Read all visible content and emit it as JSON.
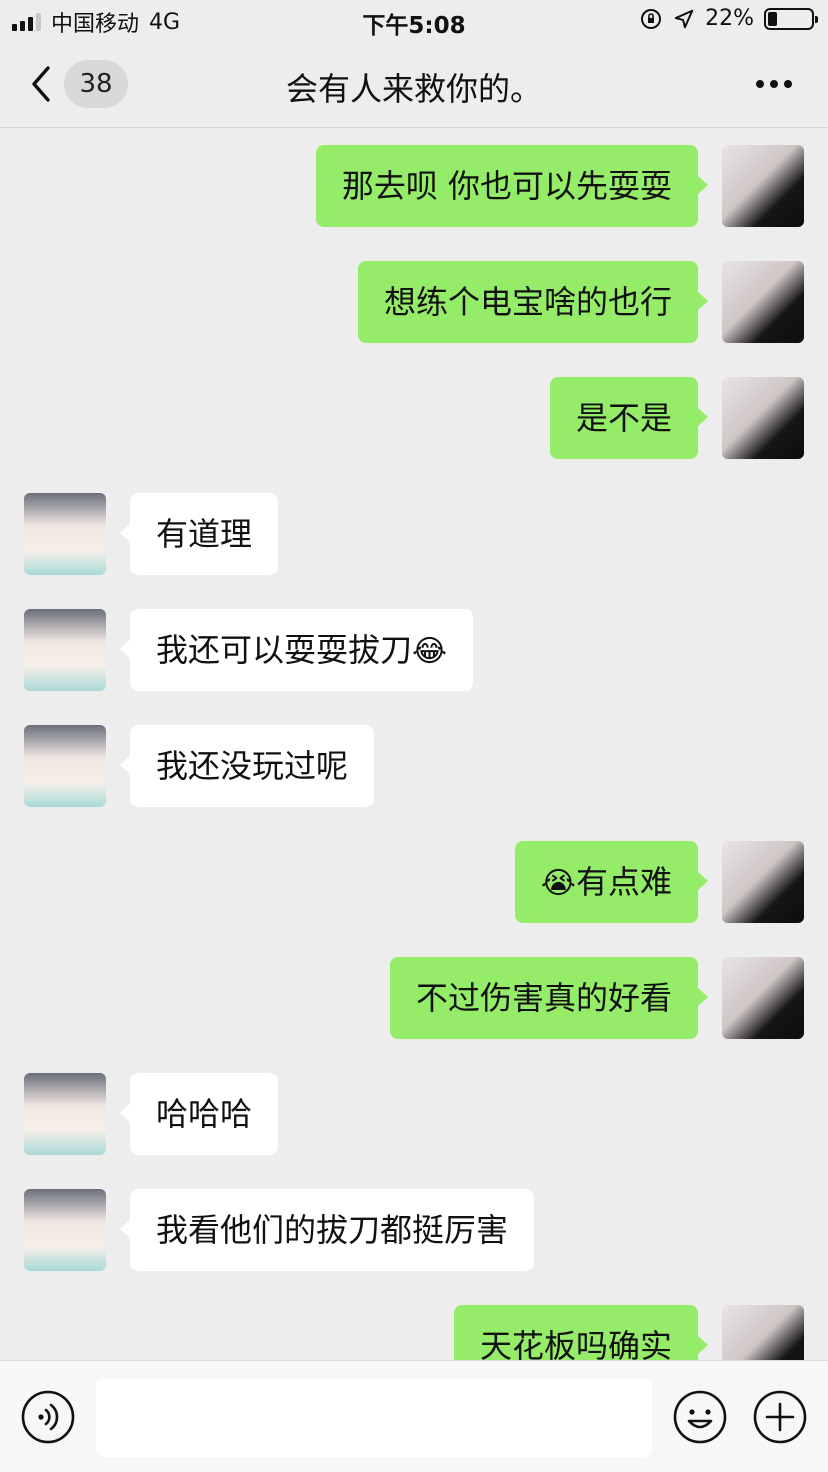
{
  "status_bar": {
    "carrier": "中国移动",
    "network": "4G",
    "time": "下午5:08",
    "battery": "22%",
    "battery_level": 0.22
  },
  "nav": {
    "unread_count": "38",
    "title": "会有人来救你的。"
  },
  "messages": [
    {
      "from": "me",
      "text": "那去呗 你也可以先耍耍"
    },
    {
      "from": "me",
      "text": "想练个电宝啥的也行"
    },
    {
      "from": "me",
      "text": "是不是"
    },
    {
      "from": "them",
      "text": "有道理"
    },
    {
      "from": "them",
      "text": "我还可以耍耍拔刀",
      "emoji_after": "😂"
    },
    {
      "from": "them",
      "text": "我还没玩过呢"
    },
    {
      "from": "me",
      "text": "有点难",
      "emoji_before": "😭"
    },
    {
      "from": "me",
      "text": "不过伤害真的好看"
    },
    {
      "from": "them",
      "text": "哈哈哈"
    },
    {
      "from": "them",
      "text": "我看他们的拔刀都挺厉害"
    },
    {
      "from": "me",
      "text": "天花板吗确实"
    }
  ],
  "icons": {
    "back": "chevron-left-icon",
    "more": "more-dots-icon",
    "voice": "voice-icon",
    "emoji": "smiley-icon",
    "plus": "plus-icon"
  }
}
